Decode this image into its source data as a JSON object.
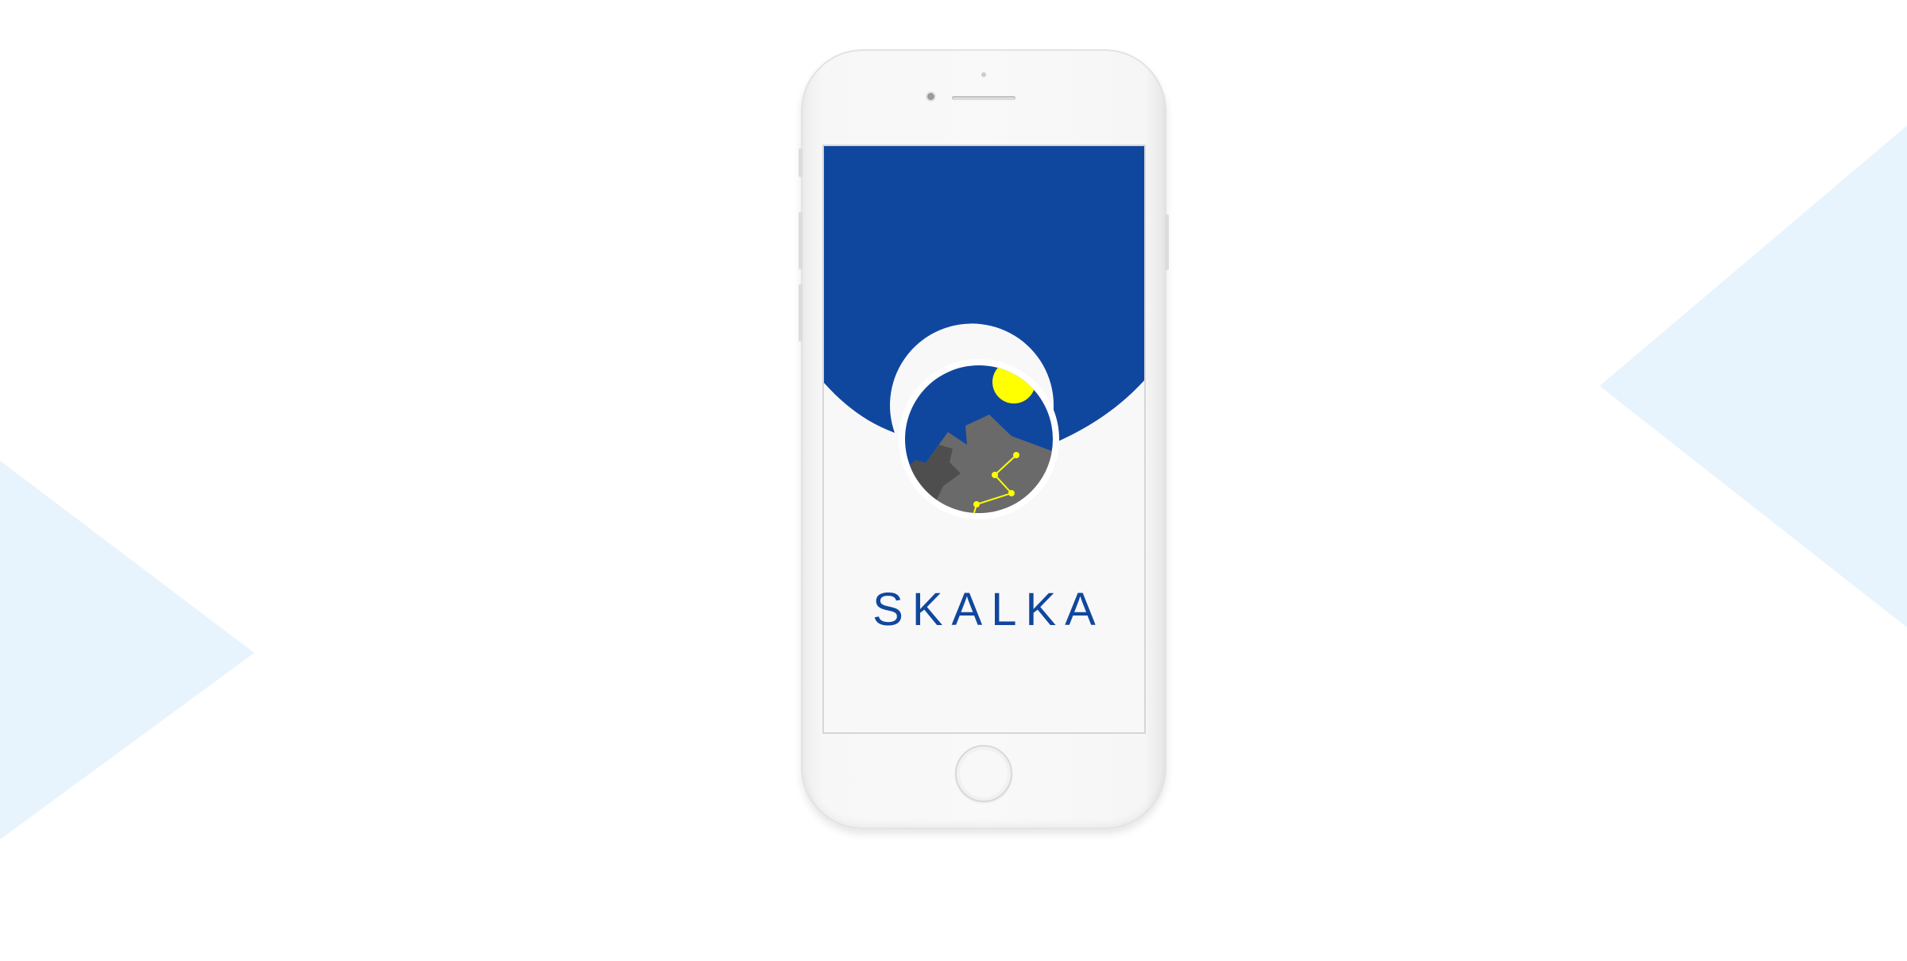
{
  "app": {
    "name": "SKALKA"
  },
  "colors": {
    "brand_blue": "#10479e",
    "sun_yellow": "#ffff00",
    "rock_gray": "#6a6a6a",
    "rock_dark": "#4e4e4e",
    "screen_background": "#f9f8f9",
    "backdrop_shape": "#e8f4fd"
  },
  "logo": {
    "elements": [
      "sun-icon",
      "mountain-icon",
      "climbing-route-icon"
    ]
  }
}
